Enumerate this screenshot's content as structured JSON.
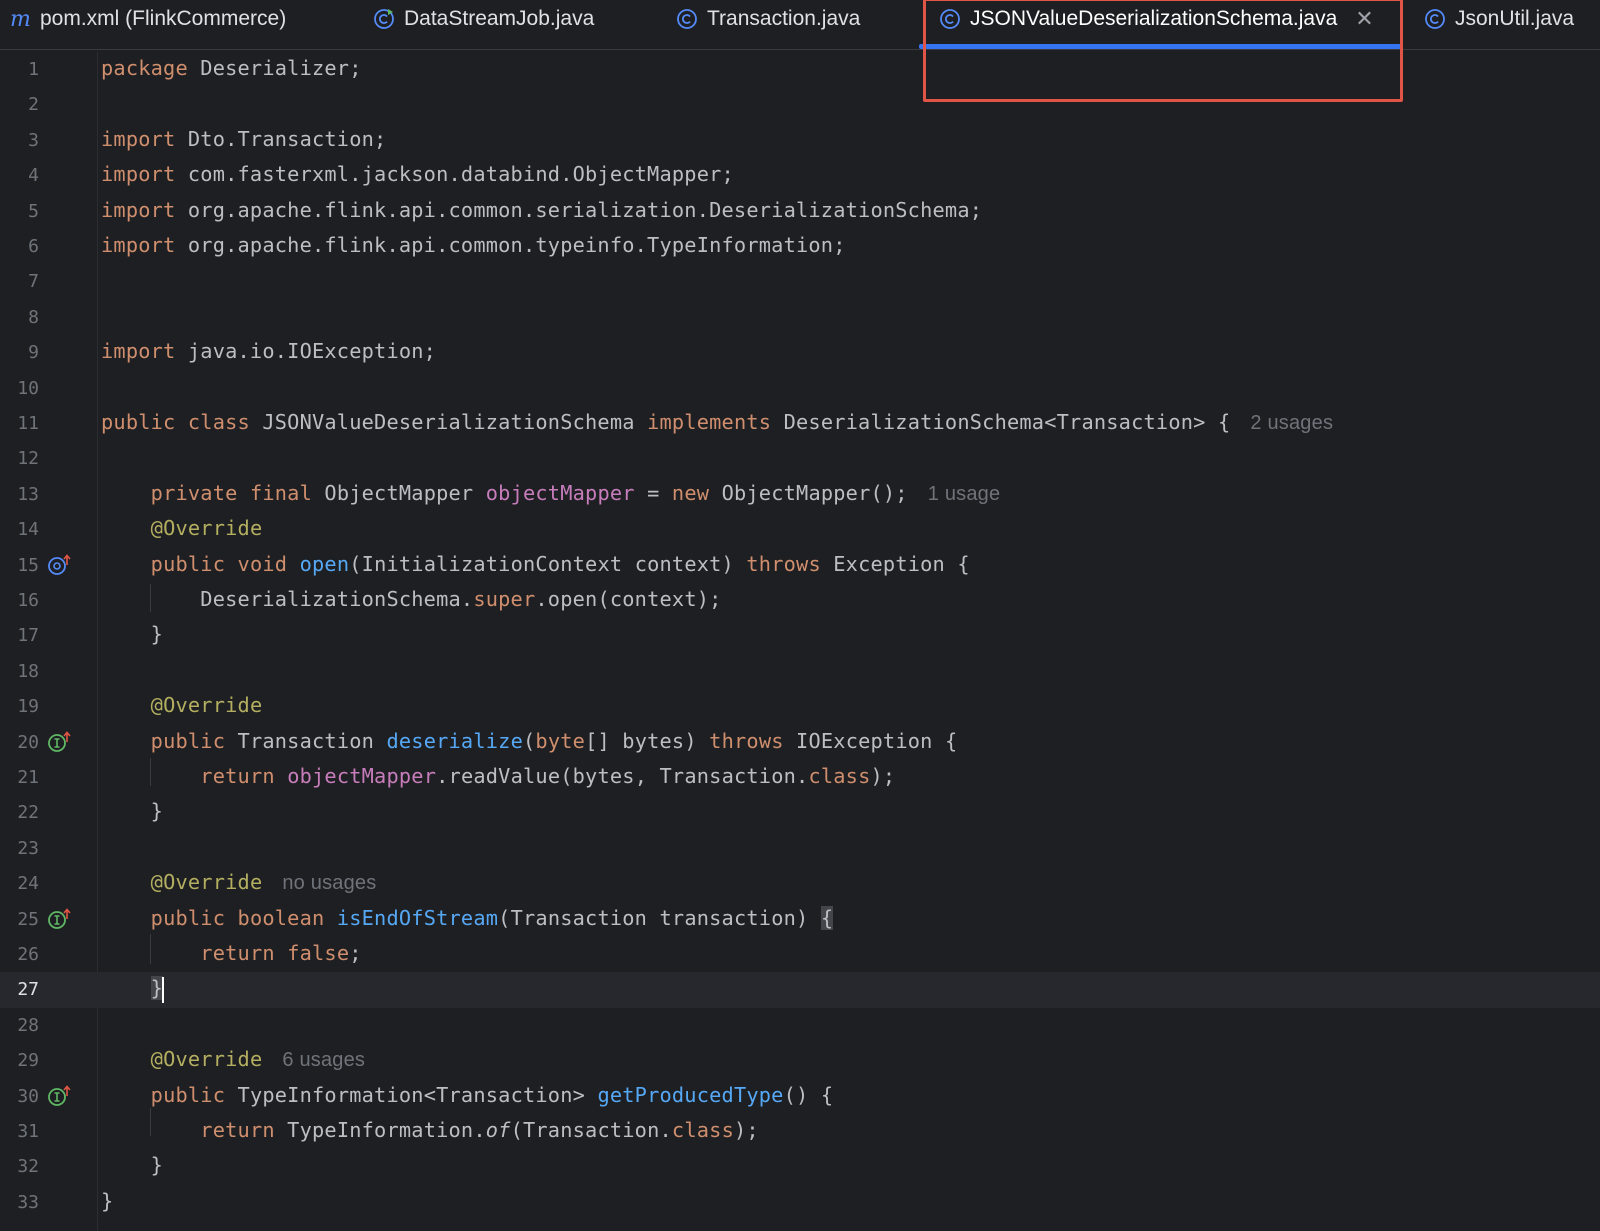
{
  "tabs": [
    {
      "label": "pom.xml (FlinkCommerce)",
      "icon": "maven-m-icon",
      "active": false
    },
    {
      "label": "DataStreamJob.java",
      "icon": "runnable-class-icon",
      "active": false
    },
    {
      "label": "Transaction.java",
      "icon": "class-icon",
      "active": false
    },
    {
      "label": "JSONValueDeserializationSchema.java",
      "icon": "class-icon",
      "active": true
    },
    {
      "label": "JsonUtil.java",
      "icon": "class-icon",
      "active": false
    }
  ],
  "colors": {
    "background": "#1e1f22",
    "keyword": "#cf8e6d",
    "annotation": "#b3ae60",
    "field": "#c77dbb",
    "method": "#56a8f5",
    "tab_underline": "#3574f0",
    "highlight_box": "#e05545",
    "gutter_green": "#5fb865",
    "gutter_blue": "#548af7"
  },
  "editor": {
    "current_line": 27,
    "line_numbers": [
      "1",
      "2",
      "3",
      "4",
      "5",
      "6",
      "7",
      "8",
      "9",
      "10",
      "11",
      "12",
      "13",
      "14",
      "15",
      "16",
      "17",
      "18",
      "19",
      "20",
      "21",
      "22",
      "23",
      "24",
      "25",
      "26",
      "27",
      "28",
      "29",
      "30",
      "31",
      "32",
      "33"
    ],
    "l1": {
      "kw": "package",
      "rest": " Deserializer;"
    },
    "l3": {
      "kw": "import",
      "rest": " Dto.Transaction;"
    },
    "l4": {
      "kw": "import",
      "rest": " com.fasterxml.jackson.databind.ObjectMapper;"
    },
    "l5": {
      "kw": "import",
      "rest": " org.apache.flink.api.common.serialization.DeserializationSchema;"
    },
    "l6": {
      "kw": "import",
      "rest": " org.apache.flink.api.common.typeinfo.TypeInformation;"
    },
    "l9": {
      "kw": "import",
      "rest": " java.io.IOException;"
    },
    "l11": {
      "kw1": "public class",
      "name": " JSONValueDeserializationSchema ",
      "kw2": "implements",
      "rest": " DeserializationSchema<Transaction> {",
      "hint": "2 usages"
    },
    "l13": {
      "kw1": "private final",
      "t1": " ObjectMapper ",
      "field": "objectMapper",
      "t2": " = ",
      "kw2": "new",
      "t3": " ObjectMapper();",
      "hint": "1 usage"
    },
    "l14": {
      "ann": "@Override"
    },
    "l15": {
      "kw1": "public void",
      "sp": " ",
      "fn": "open",
      "t1": "(InitializationContext context) ",
      "kw2": "throws",
      "t2": " Exception {"
    },
    "l16": {
      "t1": "DeserializationSchema.",
      "kw": "super",
      "t2": ".open(context);"
    },
    "l17": {
      "t": "}"
    },
    "l19": {
      "ann": "@Override"
    },
    "l20": {
      "kw1": "public",
      "t1": " Transaction ",
      "fn": "deserialize",
      "t2": "(",
      "kw2": "byte",
      "t3": "[] bytes) ",
      "kw3": "throws",
      "t4": " IOException {"
    },
    "l21": {
      "kw1": "return",
      "sp": " ",
      "field": "objectMapper",
      "t1": ".readValue(bytes, Transaction.",
      "kw2": "class",
      "t2": ");"
    },
    "l22": {
      "t": "}"
    },
    "l24": {
      "ann": "@Override",
      "hint": "no usages"
    },
    "l25": {
      "kw1": "public boolean",
      "sp": " ",
      "fn": "isEndOfStream",
      "t1": "(Transaction transaction) ",
      "brace": "{"
    },
    "l26": {
      "kw1": "return",
      "sp": " ",
      "kw2": "false",
      "t1": ";"
    },
    "l27": {
      "brace": "}"
    },
    "l29": {
      "ann": "@Override",
      "hint": "6 usages"
    },
    "l30": {
      "kw1": "public",
      "t1": " TypeInformation<Transaction> ",
      "fn": "getProducedType",
      "t2": "() {"
    },
    "l31": {
      "kw1": "return",
      "t1": " TypeInformation.",
      "itl": "of",
      "t2": "(Transaction.",
      "kw2": "class",
      "t3": ");"
    },
    "l32": {
      "t": "}"
    },
    "l33": {
      "t": "}"
    }
  }
}
